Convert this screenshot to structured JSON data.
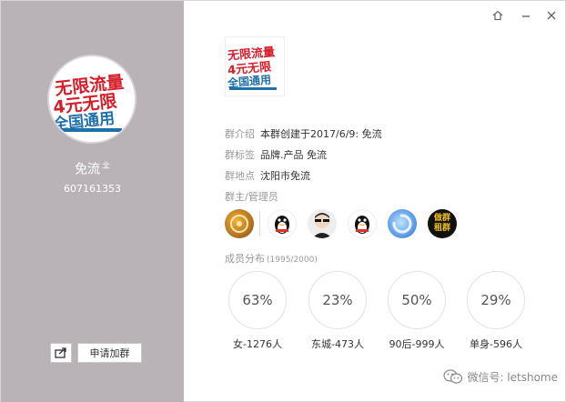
{
  "window": {
    "controls": [
      "home-icon",
      "minimize-icon",
      "close-icon"
    ]
  },
  "group": {
    "logo_text": [
      "无限流量",
      "4元无限",
      "全国通用"
    ],
    "name": "免流",
    "name_badge": "㐀",
    "id": "607161353"
  },
  "actions": {
    "share_icon": "share-icon",
    "join_label": "申请加群"
  },
  "info": [
    {
      "key": "群介绍",
      "value": "本群创建于2017/6/9: 免流"
    },
    {
      "key": "群标签",
      "value": "品牌.产品  免流"
    },
    {
      "key": "群地点",
      "value": "沈阳市免流"
    }
  ],
  "admins_title": "群主/管理员",
  "admins": [
    {
      "icon": "owner-avatar"
    },
    {
      "icon": "qq-penguin-avatar"
    },
    {
      "icon": "sunglasses-avatar"
    },
    {
      "icon": "qq-penguin-avatar"
    },
    {
      "icon": "blue-swirl-avatar"
    },
    {
      "icon": "rent-group-avatar",
      "text": [
        "做群",
        "租群"
      ]
    }
  ],
  "members_title": "成员分布",
  "members_count": "(1995/2000)",
  "stats": [
    {
      "percent": "63%",
      "label": "女-1276人"
    },
    {
      "percent": "23%",
      "label": "东城-473人"
    },
    {
      "percent": "50%",
      "label": "90后-999人"
    },
    {
      "percent": "29%",
      "label": "单身-596人"
    }
  ],
  "watermark": "微信号: letshome",
  "colors": {
    "sidebar": "#b9b3b8",
    "logo_red": "#d61e2b",
    "logo_blue": "#1f6fa8"
  }
}
